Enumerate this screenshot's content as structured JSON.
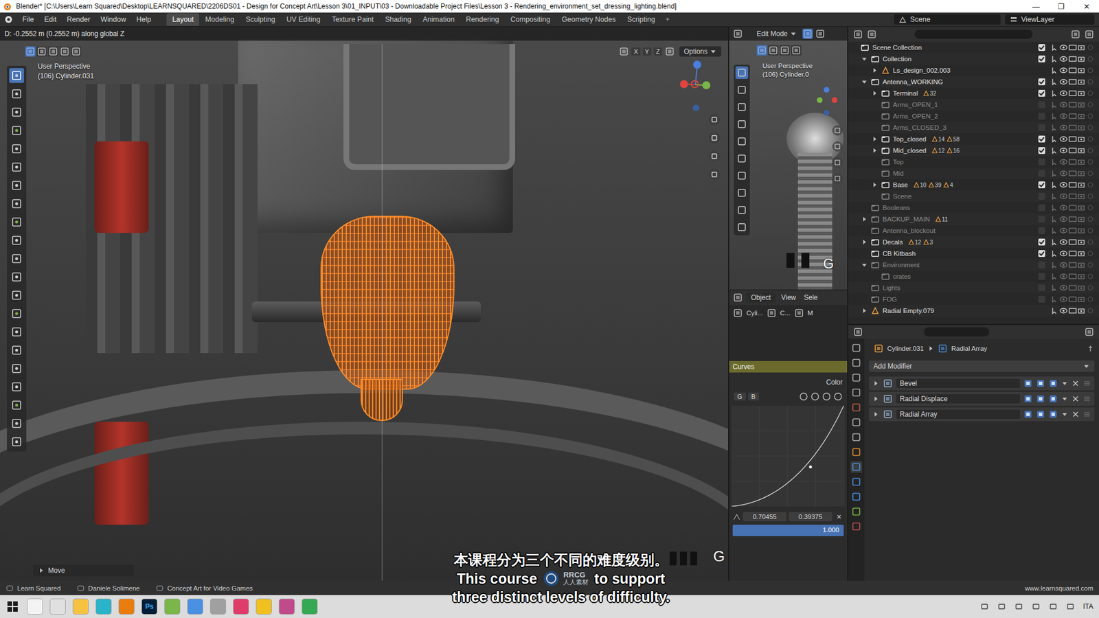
{
  "window": {
    "title": "Blender* [C:\\Users\\Learn Squared\\Desktop\\LEARNSQUARED\\2206DS01 - Design for Concept Art\\Lesson 3\\01_INPUT\\03 - Downloadable Project Files\\Lesson 3 - Rendering_environment_set_dressing_lighting.blend]",
    "controls": [
      "—",
      "❐",
      "✕"
    ]
  },
  "menu": [
    "File",
    "Edit",
    "Render",
    "Window",
    "Help"
  ],
  "workspaces": [
    {
      "label": "Layout",
      "selected": true
    },
    {
      "label": "Modeling",
      "selected": false
    },
    {
      "label": "Sculpting",
      "selected": false
    },
    {
      "label": "UV Editing",
      "selected": false
    },
    {
      "label": "Texture Paint",
      "selected": false
    },
    {
      "label": "Shading",
      "selected": false
    },
    {
      "label": "Animation",
      "selected": false
    },
    {
      "label": "Rendering",
      "selected": false
    },
    {
      "label": "Compositing",
      "selected": false
    },
    {
      "label": "Geometry Nodes",
      "selected": false
    },
    {
      "label": "Scripting",
      "selected": false
    }
  ],
  "add_workspace": "+",
  "scene": "Scene",
  "view_layer": "ViewLayer",
  "viewport": {
    "operator_info": "D: -0.2552 m (0.2552 m) along global Z",
    "view_name": "User Perspective",
    "object": "(106) Cylinder.031",
    "axes": [
      "X",
      "Y",
      "Z"
    ],
    "options": "Options",
    "last_op": "Move",
    "key_display": "G"
  },
  "side_viewport": {
    "mode": "Edit Mode",
    "view_name": "User Perspective",
    "object": "(106) Cylinder.0",
    "key_display": "G",
    "menus": [
      "Object",
      "View",
      "Sele"
    ],
    "breadcrumb": [
      "Cyli...",
      "C...",
      "M"
    ]
  },
  "curves": {
    "title": "Curves",
    "color_label": "Color",
    "channels": [
      {
        "label": "G",
        "selected": false
      },
      {
        "label": "B",
        "selected": false
      }
    ],
    "x": "0.70455",
    "y": "0.39375",
    "value": "1.000",
    "level": 1.0,
    "close": "×"
  },
  "outliner": {
    "items": [
      {
        "label": "Scene Collection",
        "depth": 0,
        "kind": "scene",
        "expandable": false,
        "expanded": false,
        "checked": true,
        "badges": []
      },
      {
        "label": "Collection",
        "depth": 1,
        "kind": "collection",
        "expandable": true,
        "expanded": true,
        "checked": true,
        "badges": []
      },
      {
        "label": "Ls_design_002.003",
        "depth": 2,
        "kind": "object",
        "expandable": true,
        "expanded": false,
        "checked": true,
        "badges": []
      },
      {
        "label": "Antenna_WORKING",
        "depth": 1,
        "kind": "collection",
        "expandable": true,
        "expanded": true,
        "checked": true,
        "badges": []
      },
      {
        "label": "Terminal",
        "depth": 2,
        "kind": "collection",
        "expandable": true,
        "expanded": false,
        "checked": true,
        "badges": [
          "32"
        ]
      },
      {
        "label": "Arms_OPEN_1",
        "depth": 2,
        "kind": "collection",
        "expandable": false,
        "expanded": false,
        "checked": false,
        "badges": []
      },
      {
        "label": "Arms_OPEN_2",
        "depth": 2,
        "kind": "collection",
        "expandable": false,
        "expanded": false,
        "checked": false,
        "badges": []
      },
      {
        "label": "Arms_CLOSED_3",
        "depth": 2,
        "kind": "collection",
        "expandable": false,
        "expanded": false,
        "checked": false,
        "badges": []
      },
      {
        "label": "Top_closed",
        "depth": 2,
        "kind": "collection",
        "expandable": true,
        "expanded": false,
        "checked": true,
        "badges": [
          "14",
          "58"
        ]
      },
      {
        "label": "Mid_closed",
        "depth": 2,
        "kind": "collection",
        "expandable": true,
        "expanded": false,
        "checked": true,
        "badges": [
          "12",
          "16"
        ]
      },
      {
        "label": "Top",
        "depth": 2,
        "kind": "collection",
        "expandable": false,
        "expanded": false,
        "checked": false,
        "badges": []
      },
      {
        "label": "Mid",
        "depth": 2,
        "kind": "collection",
        "expandable": false,
        "expanded": false,
        "checked": false,
        "badges": []
      },
      {
        "label": "Base",
        "depth": 2,
        "kind": "collection",
        "expandable": true,
        "expanded": false,
        "checked": true,
        "badges": [
          "10",
          "39",
          "4"
        ]
      },
      {
        "label": "Scene",
        "depth": 2,
        "kind": "collection",
        "expandable": false,
        "expanded": false,
        "checked": false,
        "badges": []
      },
      {
        "label": "Booleans",
        "depth": 1,
        "kind": "collection",
        "expandable": false,
        "expanded": false,
        "checked": false,
        "badges": []
      },
      {
        "label": "BACKUP_MAIN",
        "depth": 1,
        "kind": "collection",
        "expandable": true,
        "expanded": false,
        "checked": false,
        "badges": [
          "11"
        ]
      },
      {
        "label": "Antenna_blockout",
        "depth": 1,
        "kind": "collection",
        "expandable": false,
        "expanded": false,
        "checked": false,
        "badges": []
      },
      {
        "label": "Decals",
        "depth": 1,
        "kind": "collection",
        "expandable": true,
        "expanded": false,
        "checked": true,
        "badges": [
          "12",
          "3"
        ]
      },
      {
        "label": "CB Kitbash",
        "depth": 1,
        "kind": "collection",
        "expandable": false,
        "expanded": false,
        "checked": true,
        "badges": []
      },
      {
        "label": "Environment",
        "depth": 1,
        "kind": "collection",
        "expandable": true,
        "expanded": true,
        "checked": false,
        "badges": []
      },
      {
        "label": "crates",
        "depth": 2,
        "kind": "collection",
        "expandable": false,
        "expanded": false,
        "checked": false,
        "badges": []
      },
      {
        "label": "Lights",
        "depth": 1,
        "kind": "collection",
        "expandable": false,
        "expanded": false,
        "checked": false,
        "badges": []
      },
      {
        "label": "FOG",
        "depth": 1,
        "kind": "collection",
        "expandable": false,
        "expanded": false,
        "checked": false,
        "badges": []
      },
      {
        "label": "Radial Empty.079",
        "depth": 1,
        "kind": "object",
        "expandable": true,
        "expanded": false,
        "checked": true,
        "badges": []
      }
    ]
  },
  "properties": {
    "object": "Cylinder.031",
    "modifier": "Radial Array",
    "add_modifier": "Add Modifier",
    "modifiers": [
      {
        "name": "Bevel",
        "expanded": false
      },
      {
        "name": "Radial Displace",
        "expanded": false
      },
      {
        "name": "Radial Array",
        "expanded": false
      }
    ]
  },
  "status_bar": {
    "items": [
      "Learn Squared",
      "Daniele Solimene",
      "Concept Art for Video Games"
    ],
    "website": "www.learnsquared.com"
  },
  "subtitles": {
    "zh": "本课程分为三个不同的难度级别。",
    "en_start": "This course",
    "en_end": "to support",
    "en_line2": "three distinct levels of difficulty."
  },
  "watermark": {
    "logo": "RRCG",
    "sub": "人人素材"
  },
  "taskbar": {
    "apps": [
      {
        "color": "#f3f3f3"
      },
      {
        "color": "#e0e0e0"
      },
      {
        "color": "#f5c242"
      },
      {
        "color": "#2ab3c9"
      },
      {
        "color": "#e87d0d"
      },
      {
        "color": "#31a8ff",
        "label": "Ps"
      },
      {
        "color": "#7ab648"
      },
      {
        "color": "#4a90e2"
      },
      {
        "color": "#a0a0a0"
      },
      {
        "color": "#e03c6a"
      },
      {
        "color": "#f0c020"
      },
      {
        "color": "#c04a8a"
      },
      {
        "color": "#34a853"
      }
    ],
    "language": "ITA"
  }
}
